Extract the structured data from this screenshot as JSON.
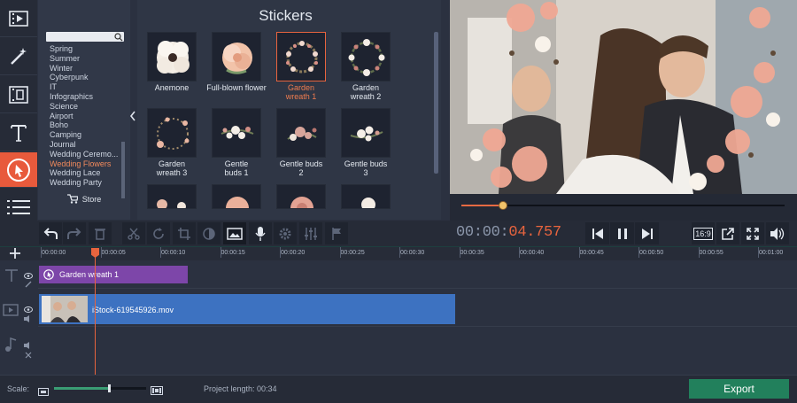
{
  "sticker_panel": {
    "title": "Stickers",
    "categories": [
      "Spring",
      "Summer",
      "Winter",
      "Cyberpunk",
      "IT",
      "Infographics",
      "Science",
      "Airport",
      "Boho",
      "Camping",
      "Journal",
      "Wedding Ceremo...",
      "Wedding Flowers",
      "Wedding Lace",
      "Wedding Party"
    ],
    "selected_category": "Wedding Flowers",
    "store_label": "Store",
    "stickers": [
      {
        "label": "Anemone"
      },
      {
        "label": "Full-blown flower"
      },
      {
        "label": "Garden wreath 1",
        "selected": true
      },
      {
        "label": "Garden wreath 2"
      },
      {
        "label": "Garden wreath 3"
      },
      {
        "label": "Gentle buds 1"
      },
      {
        "label": "Gentle buds 2"
      },
      {
        "label": "Gentle buds 3"
      }
    ]
  },
  "player": {
    "timecode_main": "00:00:",
    "timecode_accent": "04.757",
    "aspect_label": "16:9",
    "progress": 0.13
  },
  "ruler": {
    "ticks": [
      "00:00:00",
      "00:00:05",
      "00:00:10",
      "00:00:15",
      "00:00:20",
      "00:00:25",
      "00:00:30",
      "00:00:35",
      "00:00:40",
      "00:00:45",
      "00:00:50",
      "00:00:55",
      "00:01:00"
    ]
  },
  "timeline": {
    "title_clip": "Garden wreath 1",
    "video_clip": "iStock-619545926.mov"
  },
  "bottom": {
    "scale_label": "Scale:",
    "project_length": "Project length:  00:34",
    "export_label": "Export",
    "scale_value": 0.6
  },
  "colors": {
    "accent": "#e8643e",
    "title_clip": "#7d46a9",
    "video_clip": "#3d72c1",
    "export": "#22805c"
  }
}
